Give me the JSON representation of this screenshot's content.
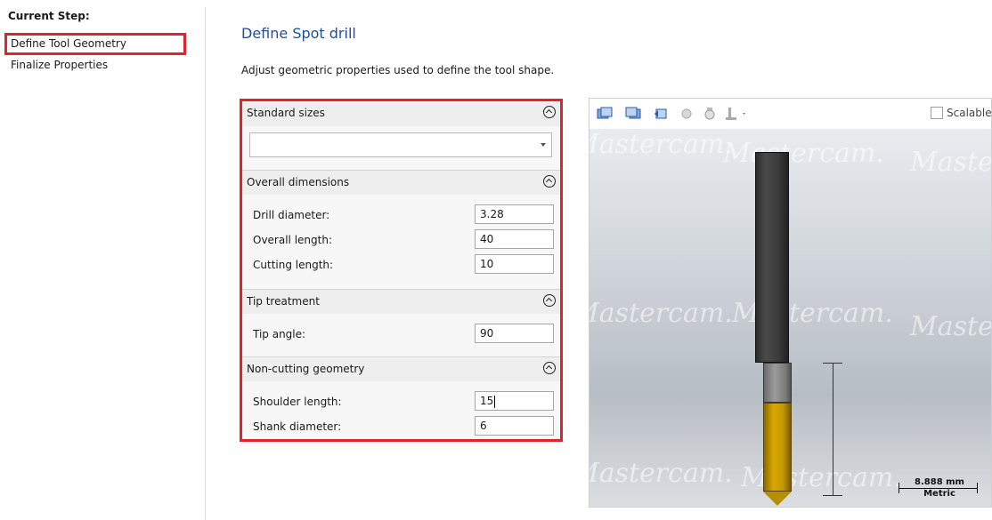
{
  "sidebar": {
    "header": "Current Step:",
    "steps": [
      "Define Tool Geometry",
      "Finalize Properties"
    ]
  },
  "main": {
    "title": "Define Spot drill",
    "description": "Adjust geometric properties used to define the tool shape."
  },
  "sections": {
    "standard_sizes": {
      "label": "Standard sizes",
      "value": ""
    },
    "overall_dimensions": {
      "label": "Overall dimensions",
      "drill_diameter": {
        "label": "Drill diameter:",
        "value": "3.28"
      },
      "overall_length": {
        "label": "Overall length:",
        "value": "40"
      },
      "cutting_length": {
        "label": "Cutting length:",
        "value": "10"
      }
    },
    "tip_treatment": {
      "label": "Tip treatment",
      "tip_angle": {
        "label": "Tip angle:",
        "value": "90"
      }
    },
    "non_cutting": {
      "label": "Non-cutting geometry",
      "shoulder_length": {
        "label": "Shoulder length:",
        "value": "15"
      },
      "shank_diameter": {
        "label": "Shank diameter:",
        "value": "6"
      }
    }
  },
  "preview": {
    "scalable_label": "Scalable",
    "watermark": "Mastercam.",
    "scale_value": "8.888 mm",
    "scale_unit": "Metric",
    "toolbar_icons": [
      "view-left-icon",
      "view-right-icon",
      "rotate-icon",
      "iso-view-icon",
      "fit-view-icon",
      "tool-holder-icon"
    ]
  },
  "colors": {
    "accent_red": "#e0242b",
    "title_blue": "#1f4e99",
    "flute_gold": "#d7a800"
  }
}
